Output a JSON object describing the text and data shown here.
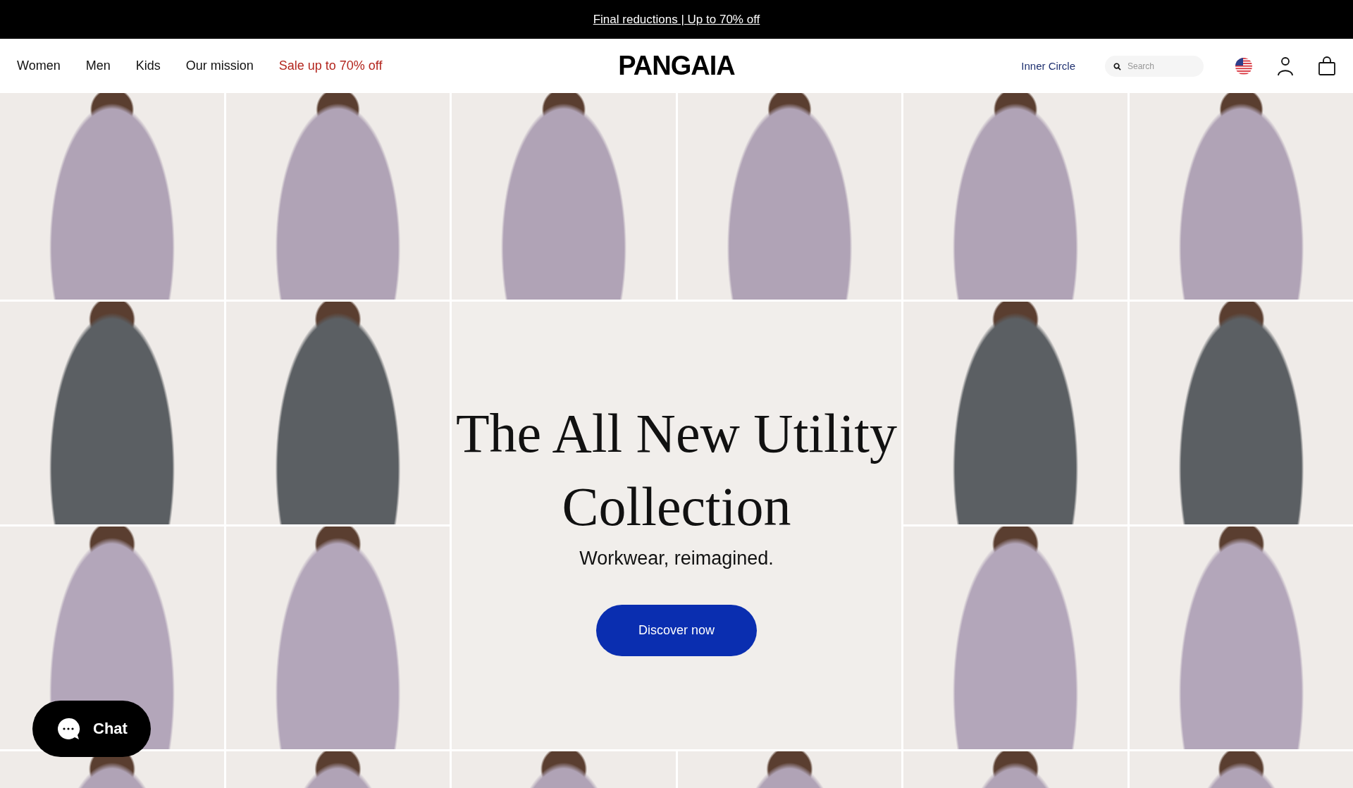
{
  "announcement": "Final reductions | Up to 70% off",
  "nav": [
    {
      "label": "Women",
      "kind": "normal"
    },
    {
      "label": "Men",
      "kind": "normal"
    },
    {
      "label": "Kids",
      "kind": "normal"
    },
    {
      "label": "Our mission",
      "kind": "normal"
    },
    {
      "label": "Sale up to 70% off",
      "kind": "sale"
    }
  ],
  "logo": "PANGAIA",
  "account_link": "Inner Circle",
  "search": {
    "placeholder": "Search"
  },
  "hero": {
    "title": "The All New Utility Collection",
    "subtitle": "Workwear, reimagined.",
    "button": "Discover now"
  },
  "chat": {
    "label": "Chat"
  }
}
